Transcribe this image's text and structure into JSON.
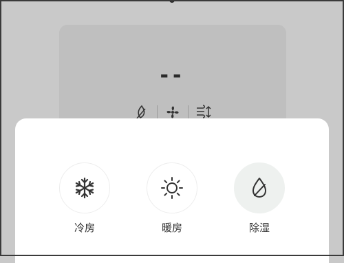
{
  "display": {
    "temperature": "--"
  },
  "status_icons": [
    "leaf-icon",
    "fan-icon",
    "wind-swing-icon"
  ],
  "modes": [
    {
      "label": "冷房",
      "icon": "snowflake-icon"
    },
    {
      "label": "暖房",
      "icon": "sun-icon"
    },
    {
      "label": "除湿",
      "icon": "water-drop-icon",
      "selected": true
    }
  ],
  "colors": {
    "overlay": "#c9c9c9",
    "sheet": "#ffffff",
    "icon": "#333333",
    "selected_bg": "#eef1ef"
  }
}
